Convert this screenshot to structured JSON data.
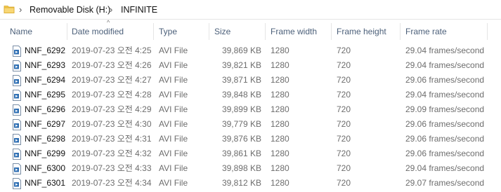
{
  "breadcrumb": {
    "drive": "Removable Disk (H:)",
    "folder": "INFINITE"
  },
  "columns": {
    "name": "Name",
    "date_modified": "Date modified",
    "type": "Type",
    "size": "Size",
    "frame_width": "Frame width",
    "frame_height": "Frame height",
    "frame_rate": "Frame rate"
  },
  "files": [
    {
      "name": "NNF_6292",
      "date": "2019-07-23 오전 4:25",
      "type": "AVI File",
      "size": "39,869 KB",
      "frame_width": "1280",
      "frame_height": "720",
      "frame_rate": "29.04 frames/second"
    },
    {
      "name": "NNF_6293",
      "date": "2019-07-23 오전 4:26",
      "type": "AVI File",
      "size": "39,821 KB",
      "frame_width": "1280",
      "frame_height": "720",
      "frame_rate": "29.04 frames/second"
    },
    {
      "name": "NNF_6294",
      "date": "2019-07-23 오전 4:27",
      "type": "AVI File",
      "size": "39,871 KB",
      "frame_width": "1280",
      "frame_height": "720",
      "frame_rate": "29.06 frames/second"
    },
    {
      "name": "NNF_6295",
      "date": "2019-07-23 오전 4:28",
      "type": "AVI File",
      "size": "39,848 KB",
      "frame_width": "1280",
      "frame_height": "720",
      "frame_rate": "29.04 frames/second"
    },
    {
      "name": "NNF_6296",
      "date": "2019-07-23 오전 4:29",
      "type": "AVI File",
      "size": "39,899 KB",
      "frame_width": "1280",
      "frame_height": "720",
      "frame_rate": "29.09 frames/second"
    },
    {
      "name": "NNF_6297",
      "date": "2019-07-23 오전 4:30",
      "type": "AVI File",
      "size": "39,779 KB",
      "frame_width": "1280",
      "frame_height": "720",
      "frame_rate": "29.06 frames/second"
    },
    {
      "name": "NNF_6298",
      "date": "2019-07-23 오전 4:31",
      "type": "AVI File",
      "size": "39,876 KB",
      "frame_width": "1280",
      "frame_height": "720",
      "frame_rate": "29.06 frames/second"
    },
    {
      "name": "NNF_6299",
      "date": "2019-07-23 오전 4:32",
      "type": "AVI File",
      "size": "39,861 KB",
      "frame_width": "1280",
      "frame_height": "720",
      "frame_rate": "29.06 frames/second"
    },
    {
      "name": "NNF_6300",
      "date": "2019-07-23 오전 4:33",
      "type": "AVI File",
      "size": "39,898 KB",
      "frame_width": "1280",
      "frame_height": "720",
      "frame_rate": "29.04 frames/second"
    },
    {
      "name": "NNF_6301",
      "date": "2019-07-23 오전 4:34",
      "type": "AVI File",
      "size": "39,812 KB",
      "frame_width": "1280",
      "frame_height": "720",
      "frame_rate": "29.07 frames/second"
    }
  ],
  "colors": {
    "header_text": "#4c607a",
    "folder_yellow": "#f2c94c",
    "file_icon_blue": "#2f6fb3"
  }
}
